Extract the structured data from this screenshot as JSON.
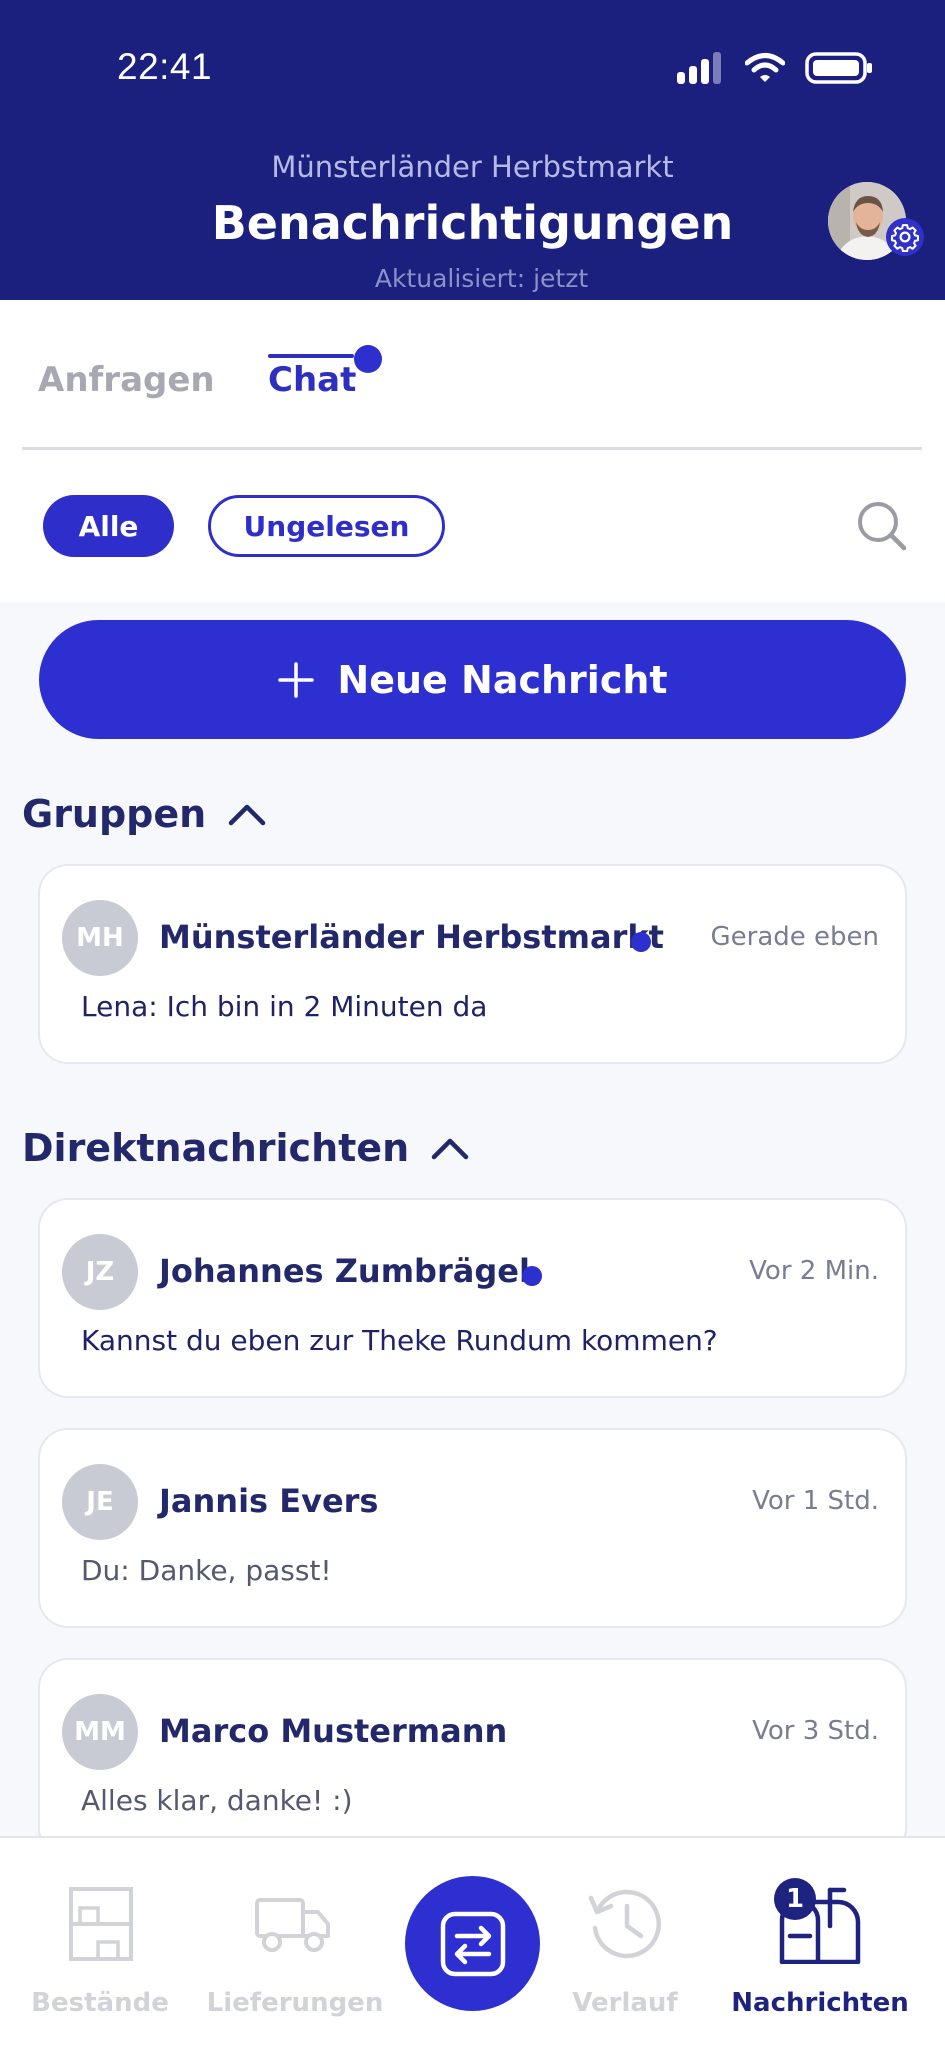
{
  "status_bar": {
    "time": "22:41"
  },
  "header": {
    "subtitle": "Münsterländer Herbstmarkt",
    "title": "Benachrichtigungen",
    "updated": "Aktualisiert: jetzt"
  },
  "tabs": [
    {
      "label": "Anfragen",
      "active": false
    },
    {
      "label": "Chat",
      "active": true,
      "has_unread": true
    }
  ],
  "filters": [
    {
      "label": "Alle",
      "selected": true
    },
    {
      "label": "Ungelesen",
      "selected": false
    }
  ],
  "new_message_button": {
    "label": "Neue Nachricht"
  },
  "sections": {
    "groups": {
      "title": "Gruppen",
      "items": [
        {
          "initials": "MH",
          "name": "Münsterländer Herbstmarkt",
          "unread": true,
          "time": "Gerade eben",
          "message": "Lena: Ich bin in 2 Minuten da"
        }
      ]
    },
    "direct": {
      "title": "Direktnachrichten",
      "items": [
        {
          "initials": "JZ",
          "name": "Johannes Zumbrägel",
          "unread": true,
          "time": "Vor 2 Min.",
          "message": "Kannst du eben zur Theke Rundum kommen?"
        },
        {
          "initials": "JE",
          "name": "Jannis Evers",
          "unread": false,
          "time": "Vor 1 Std.",
          "message": "Du: Danke, passt!"
        },
        {
          "initials": "MM",
          "name": "Marco Mustermann",
          "unread": false,
          "time": "Vor 3 Std.",
          "message": "Alles klar, danke! :)"
        }
      ]
    }
  },
  "bottom_nav": {
    "items": [
      {
        "label": "Bestände",
        "icon": "shelf-icon",
        "active": false
      },
      {
        "label": "Lieferungen",
        "icon": "truck-icon",
        "active": false
      },
      {
        "label": "",
        "icon": "swap-icon",
        "active": false
      },
      {
        "label": "Verlauf",
        "icon": "history-icon",
        "active": false
      },
      {
        "label": "Nachrichten",
        "icon": "mailbox-icon",
        "active": true
      }
    ],
    "badge_count": "1"
  },
  "colors": {
    "header_bg": "#1b1f7d",
    "accent": "#2e2fd0",
    "text_dark": "#23286b",
    "page_bg": "#f7f8fc"
  }
}
